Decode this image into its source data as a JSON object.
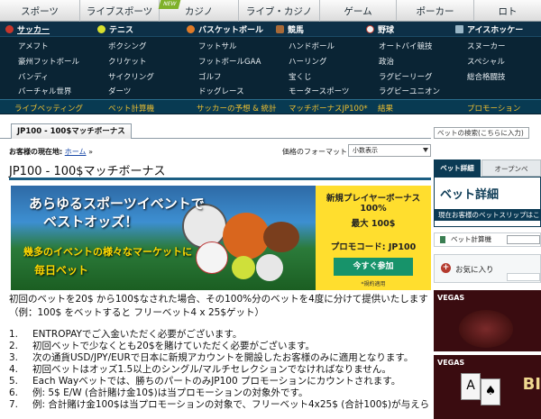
{
  "top_nav": [
    "スポーツ",
    "ライブスポーツ",
    "カジノ",
    "ライブ・カジノ",
    "ゲーム",
    "ポーカー",
    "ロト"
  ],
  "top_nav_badge": "NEW",
  "sport_headers": [
    "サッカー",
    "テニス",
    "バスケットボール",
    "競馬",
    "野球",
    "アイスホッケー"
  ],
  "sport_grid": [
    [
      "アメフト",
      "ボクシング",
      "フットサル",
      "ハンドボール",
      "オートバイ競技",
      "スヌーカー"
    ],
    [
      "豪州フットボール",
      "クリケット",
      "フットボールGAA",
      "ハーリング",
      "政治",
      "スペシャル"
    ],
    [
      "バンディ",
      "サイクリング",
      "ゴルフ",
      "宝くじ",
      "ラグビーリーグ",
      "総合格闘技"
    ],
    [
      "バーチャル世界",
      "ダーツ",
      "ドッグレース",
      "モータースポーツ",
      "ラグビーユニオン",
      ""
    ]
  ],
  "sub_nav": [
    "ライブベッティング",
    "ベット計算機",
    "サッカーの予想 & 統計",
    "マッチボーナスJP100*",
    "結果",
    "プロモーション"
  ],
  "tab": "JP100 - 100$マッチボーナス",
  "breadcrumb": {
    "label": "お客様の現在地:",
    "home": "ホーム",
    "sep": "»"
  },
  "format": {
    "label": "価格のフォーマット :",
    "value": "小数表示"
  },
  "title": "JP100 - 100$マッチボーナス",
  "banner": {
    "headline_1": "あらゆるスポーツイベントで",
    "headline_2": "ベストオッズ！",
    "sub_1": "幾多のイベントの様々なマーケットに",
    "sub_2": "毎日ベット",
    "bonus_title": "新規プレイヤーボーナス",
    "bonus_pct": "100%",
    "bonus_max": "最大 100$",
    "promo": "プロモコード: JP100",
    "join_button": "今すぐ参加",
    "terms": "*規約適用"
  },
  "description": "初回のベットを20$ から100$なされた場合、その100%分のベットを4度に分けて提供いたします（例：100$ をベットすると フリーベット4 x 25$ゲット）",
  "rules": [
    {
      "n": "1.",
      "t": "ENTROPAYでご入金いただく必要がございます。"
    },
    {
      "n": "2.",
      "t": "初回ベットで少なくとも20$を賭けていただく必要がございます。"
    },
    {
      "n": "3.",
      "t": "次の通貨USD/JPY/EURで日本に新規アカウントを開設したお客様のみに適用となります。"
    },
    {
      "n": "4.",
      "t": "初回ベットはオッズ1.5以上のシングル/マルチセレクションでなければなりません。"
    },
    {
      "n": "5.",
      "t": "Each Wayベットでは、勝ちのパートのみJP100 プロモーションにカウントされます。"
    },
    {
      "n": "6.",
      "t": "例: 5$ E/W (合計賭け金10$)は当プロモーションの対象外です。"
    },
    {
      "n": "7.",
      "t": "例: 合計賭け金100$は当プロモーションの対象で、フリーベット4x25$ (合計100$)が与えら"
    }
  ],
  "sidebar": {
    "search_placeholder": "ベットの検索(こちらに入力)",
    "tab_active": "ベット詳細",
    "tab_other": "オープンベ",
    "bet_title": "ベット詳細",
    "bet_bar": "現在お客様のベットスリップはこ",
    "calc_label": "ベット計算機",
    "fav_label": "お気に入り",
    "vegas": "VEGAS",
    "vegas_text": "BI"
  },
  "colors": {
    "nav_dark": "#0a2434",
    "accent_yellow": "#f0c030",
    "join_green": "#17936a",
    "banner_yellow": "#ffde2e"
  }
}
